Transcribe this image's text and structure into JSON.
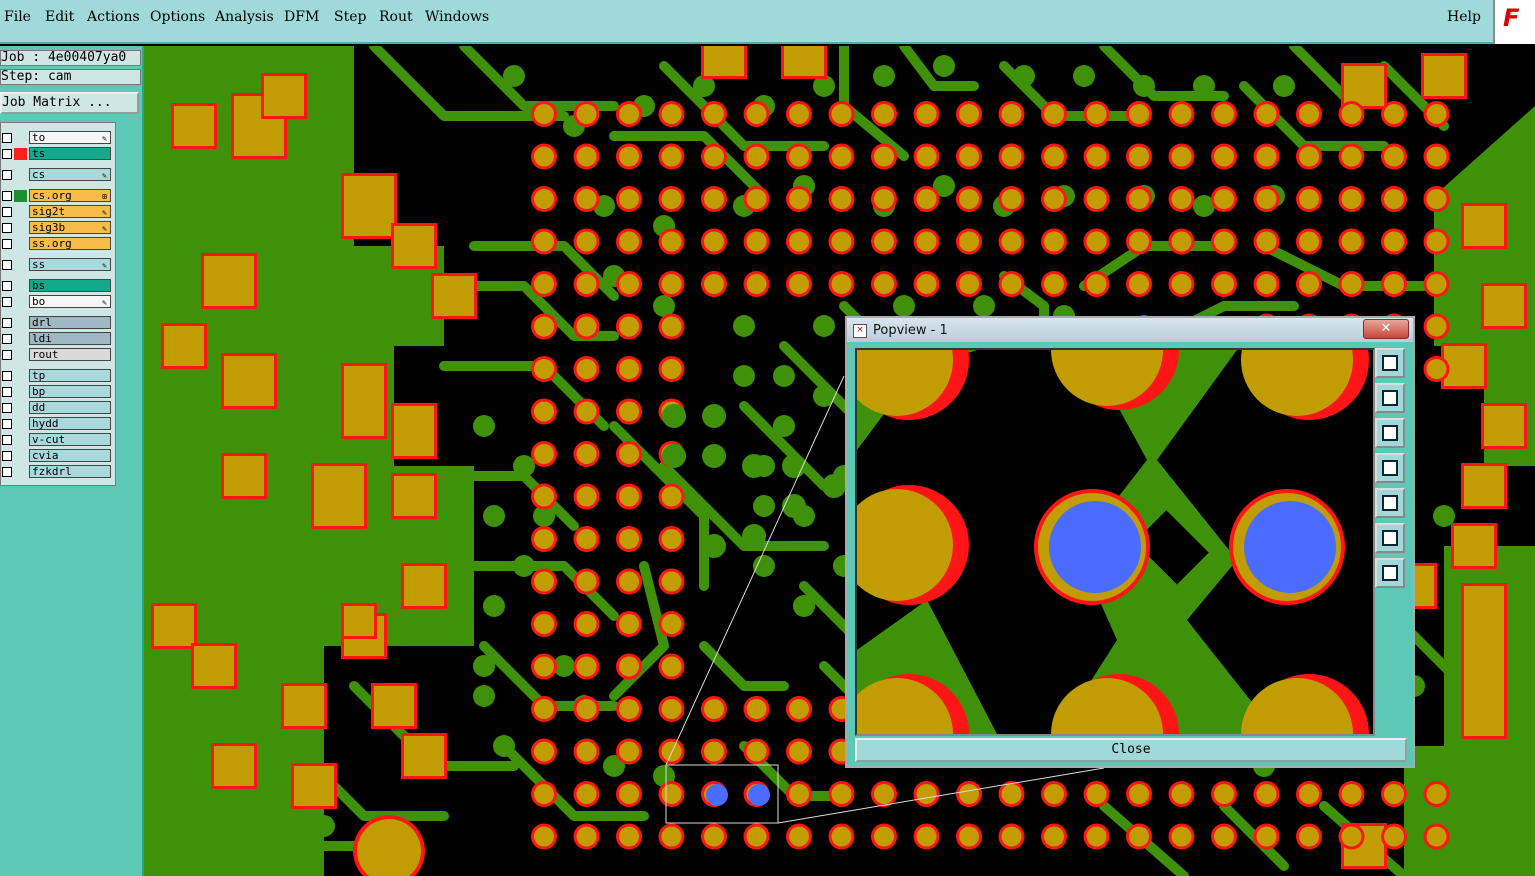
{
  "menu": {
    "items": [
      "File",
      "Edit",
      "Actions",
      "Options",
      "Analysis",
      "DFM",
      "Step",
      "Rout",
      "Windows"
    ],
    "help": "Help",
    "logo": "F"
  },
  "info": {
    "job": "Job : 4e00407ya0",
    "step": "Step: cam",
    "matrix_button": "Job Matrix ..."
  },
  "layers": [
    {
      "name": "to",
      "color": "#f6f6f6",
      "swatch": "",
      "mark": "✎"
    },
    {
      "name": "ts",
      "color": "#14a98c",
      "swatch": "#ff2020",
      "mark": ""
    },
    {
      "name": "cs",
      "color": "#a9dadb",
      "swatch": "",
      "mark": "✎"
    },
    {
      "name": "cs.org",
      "color": "#f6bd4b",
      "swatch": "#1d8f33",
      "mark": "⊞"
    },
    {
      "name": "sig2t",
      "color": "#f6bd4b",
      "swatch": "",
      "mark": "✎"
    },
    {
      "name": "sig3b",
      "color": "#f6bd4b",
      "swatch": "",
      "mark": "✎"
    },
    {
      "name": "ss.org",
      "color": "#f6bd4b",
      "swatch": "",
      "mark": ""
    },
    {
      "name": "ss",
      "color": "#a9dadb",
      "swatch": "",
      "mark": "✎"
    },
    {
      "name": "bs",
      "color": "#14a98c",
      "swatch": "",
      "mark": ""
    },
    {
      "name": "bo",
      "color": "#f6f6f6",
      "swatch": "",
      "mark": "✎"
    },
    {
      "name": "drl",
      "color": "#9fb9c4",
      "swatch": "",
      "mark": ""
    },
    {
      "name": "ldi",
      "color": "#9fb9c4",
      "swatch": "",
      "mark": ""
    },
    {
      "name": "rout",
      "color": "#d9d9d9",
      "swatch": "",
      "mark": ""
    },
    {
      "name": "tp",
      "color": "#a9dadb",
      "swatch": "",
      "mark": ""
    },
    {
      "name": "bp",
      "color": "#a9dadb",
      "swatch": "",
      "mark": ""
    },
    {
      "name": "dd",
      "color": "#a9dadb",
      "swatch": "",
      "mark": ""
    },
    {
      "name": "hydd",
      "color": "#a9dadb",
      "swatch": "",
      "mark": ""
    },
    {
      "name": "v-cut",
      "color": "#a9dadb",
      "swatch": "",
      "mark": ""
    },
    {
      "name": "cvia",
      "color": "#a9dadb",
      "swatch": "",
      "mark": ""
    },
    {
      "name": "fzkdrl",
      "color": "#a9dadb",
      "swatch": "",
      "mark": ""
    }
  ],
  "popview": {
    "title": "Popview - 1",
    "close_x": "✕",
    "close_button": "Close",
    "tool_icons": [
      "zoom-window-icon",
      "pan-up-icon",
      "pan-down-icon",
      "pan-left-icon",
      "pan-right-icon",
      "zoom-in-icon",
      "zoom-out-icon"
    ]
  },
  "colors": {
    "copper": "#3e9108",
    "pad": "#c19c03",
    "mask_ring": "#ff1515",
    "drill": "#4a6cff",
    "background": "#000000"
  }
}
